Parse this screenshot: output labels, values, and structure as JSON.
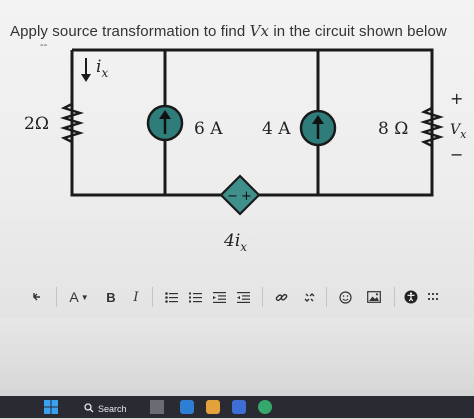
{
  "question": {
    "prefix": "Apply source transformation to find ",
    "variable": "Vx",
    "suffix": " in the circuit shown below",
    "mark": "--"
  },
  "circuit": {
    "r_left": "2Ω",
    "current_label": "i",
    "current_sub": "x",
    "source1": "6 A",
    "source2": "4 A",
    "r_right": "8 Ω",
    "plus": "+",
    "minus": "−",
    "vx": "V",
    "vx_sub": "x",
    "dep_minus": "−",
    "dep_plus": "+",
    "dep_label": "4i",
    "dep_sub": "x"
  },
  "toolbar": {
    "format_label": "A",
    "bold_label": "B",
    "italic_label": "I"
  },
  "taskbar": {
    "search_label": "Search"
  },
  "colors": {
    "wire": "#1a1a1a",
    "source_fill": "#2f7d7a",
    "dep_fill": "#3f8f8b"
  }
}
